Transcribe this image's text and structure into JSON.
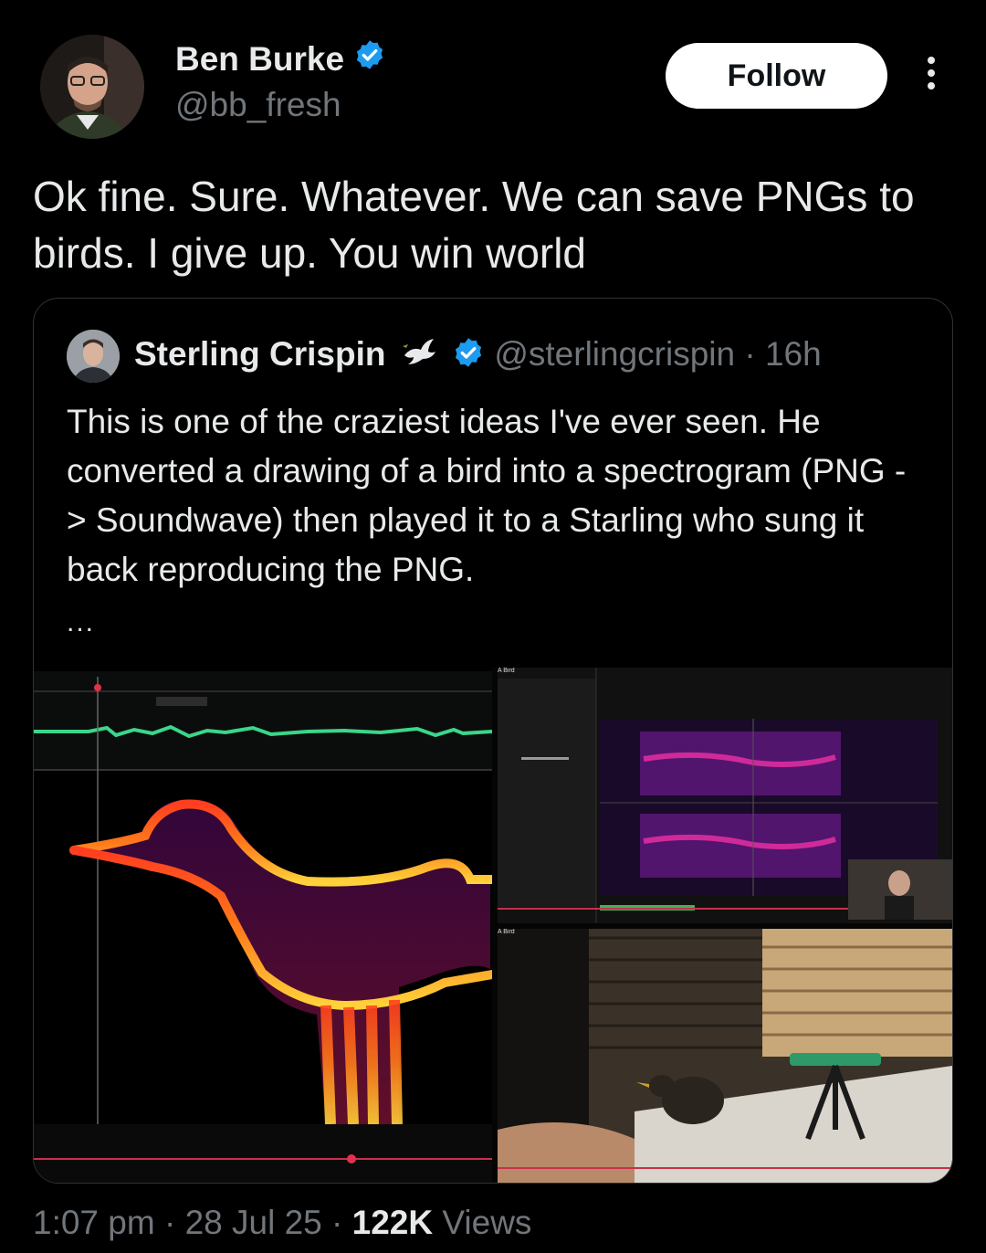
{
  "author": {
    "name": "Ben Burke",
    "handle": "@bb_fresh",
    "verified": true
  },
  "follow_label": "Follow",
  "tweet_text": "Ok fine. Sure. Whatever. We can save PNGs to birds. I give up. You win world",
  "quoted": {
    "name": "Sterling Crispin",
    "handle": "@sterlingcrispin",
    "age": "16h",
    "text": "This is one of the craziest ideas I've ever seen. He converted a drawing of a bird into a spectrogram (PNG -> Soundwave) then played it to a Starling who sung it back reproducing the PNG.",
    "ellipsis": "...",
    "media_labels": [
      "A Bird",
      "A Bird"
    ]
  },
  "footer": {
    "time": "1:07 pm",
    "date": "28 Jul 25",
    "views_count": "122K",
    "views_label": "Views"
  },
  "colors": {
    "background": "#000000",
    "text": "#e7e9ea",
    "muted": "#71767b",
    "verified": "#1d9bf0",
    "border": "#2f3336"
  }
}
